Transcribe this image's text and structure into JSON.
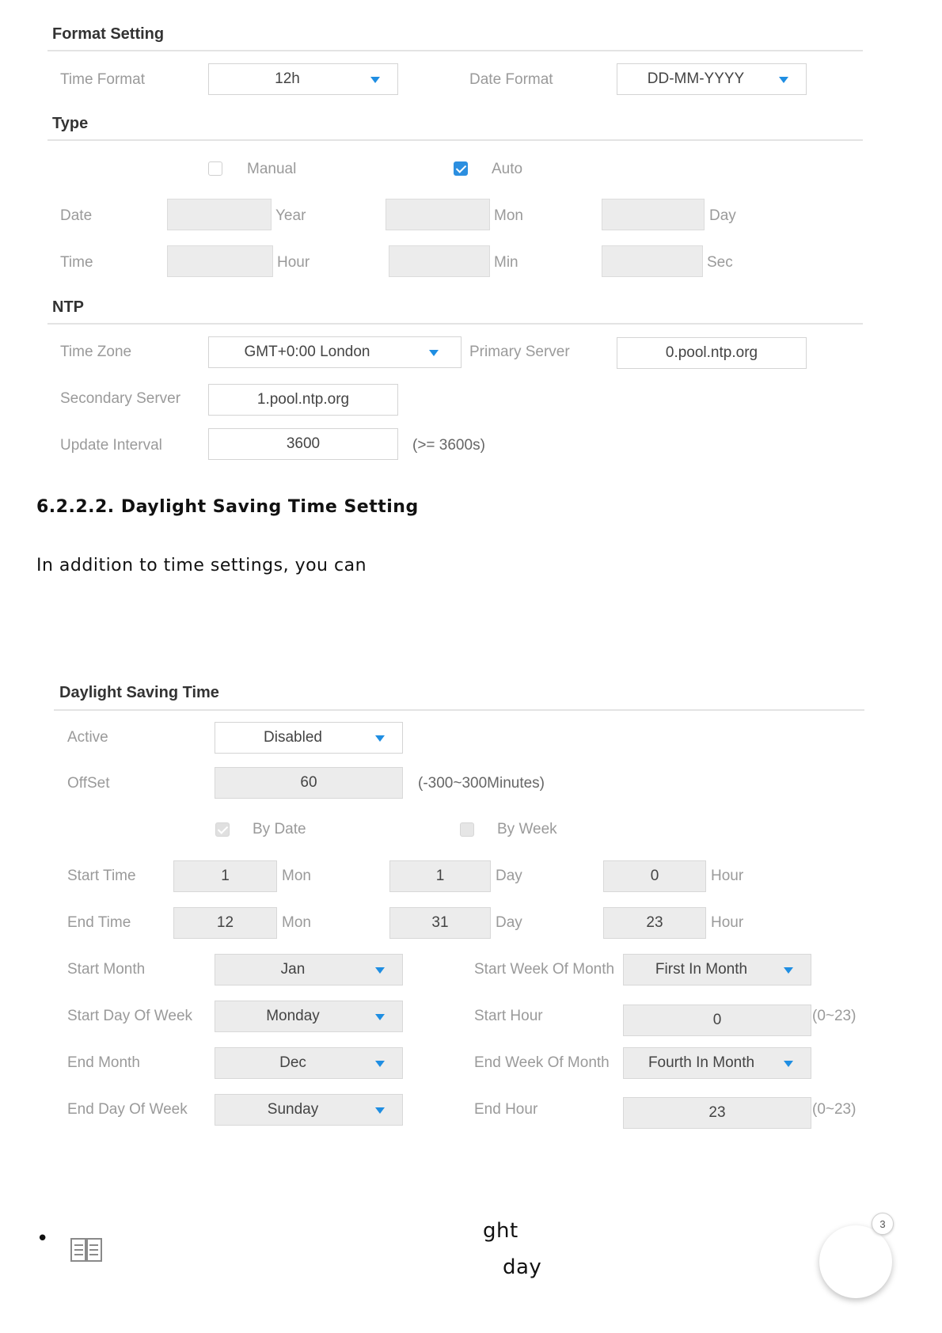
{
  "format_setting": {
    "title": "Format Setting",
    "time_format_label": "Time Format",
    "time_format_value": "12h",
    "date_format_label": "Date Format",
    "date_format_value": "DD-MM-YYYY"
  },
  "type": {
    "title": "Type",
    "manual_label": "Manual",
    "manual_checked": false,
    "auto_label": "Auto",
    "auto_checked": true,
    "date_label": "Date",
    "year_unit": "Year",
    "mon_unit": "Mon",
    "day_unit": "Day",
    "time_label": "Time",
    "hour_unit": "Hour",
    "min_unit": "Min",
    "sec_unit": "Sec"
  },
  "ntp": {
    "title": "NTP",
    "time_zone_label": "Time Zone",
    "time_zone_value": "GMT+0:00 London",
    "primary_server_label": "Primary Server",
    "primary_server_value": "0.pool.ntp.org",
    "secondary_server_label": "Secondary Server",
    "secondary_server_value": "1.pool.ntp.org",
    "update_interval_label": "Update Interval",
    "update_interval_value": "3600",
    "update_interval_hint": "(>= 3600s)"
  },
  "doc": {
    "heading": "6.2.2.2. Daylight Saving Time Setting",
    "paragraph": "In addition to time settings, you can",
    "fragment_1": "ght",
    "fragment_2": "day",
    "badge_count": "3",
    "bullet": "•"
  },
  "dst": {
    "title": "Daylight Saving Time",
    "active_label": "Active",
    "active_value": "Disabled",
    "offset_label": "OffSet",
    "offset_value": "60",
    "offset_hint": "(-300~300Minutes)",
    "by_date_label": "By Date",
    "by_week_label": "By Week",
    "start_time_label": "Start Time",
    "start_time_mon": "1",
    "start_time_day": "1",
    "start_time_hour": "0",
    "end_time_label": "End Time",
    "end_time_mon": "12",
    "end_time_day": "31",
    "end_time_hour": "23",
    "mon_unit": "Mon",
    "day_unit": "Day",
    "hour_unit": "Hour",
    "start_month_label": "Start Month",
    "start_month_value": "Jan",
    "start_week_of_month_label": "Start Week Of Month",
    "start_week_of_month_value": "First In Month",
    "start_day_of_week_label": "Start Day Of Week",
    "start_day_of_week_value": "Monday",
    "start_hour_label": "Start Hour",
    "start_hour_value": "0",
    "start_hour_hint": "(0~23)",
    "end_month_label": "End Month",
    "end_month_value": "Dec",
    "end_week_of_month_label": "End Week Of Month",
    "end_week_of_month_value": "Fourth In Month",
    "end_day_of_week_label": "End Day Of Week",
    "end_day_of_week_value": "Sunday",
    "end_hour_label": "End Hour",
    "end_hour_value": "23",
    "end_hour_hint": "(0~23)"
  },
  "colors": {
    "accent": "#2c8fe0",
    "label_gray": "#9a9a9a"
  }
}
